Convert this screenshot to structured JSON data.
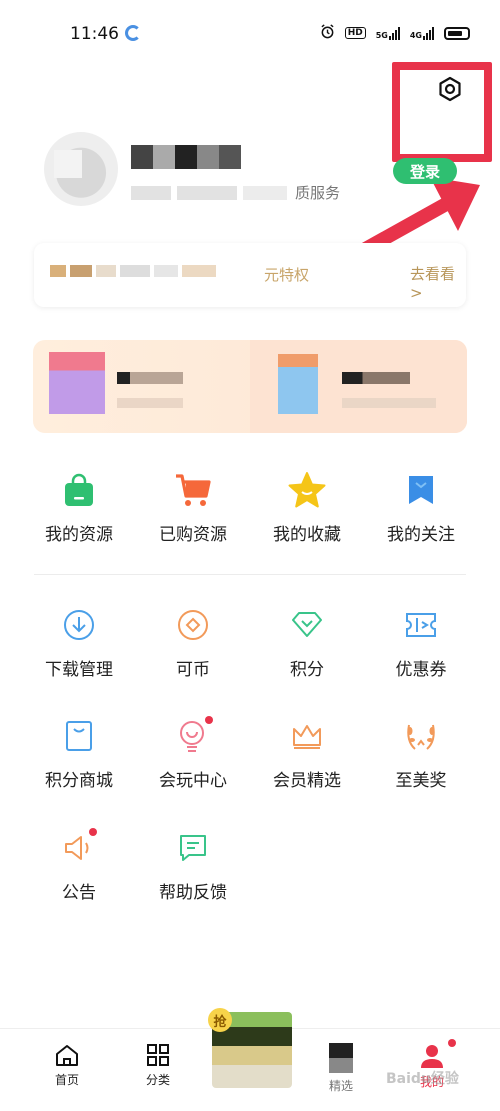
{
  "status_bar": {
    "time": "11:46",
    "hd_label": "HD",
    "net_5g": "5G",
    "net_4g": "4G"
  },
  "profile": {
    "service_text": "质服务",
    "login_label": "登录"
  },
  "privilege": {
    "text": "元特权",
    "more_label": "去看看 >"
  },
  "section_main": [
    {
      "label": "我的资源",
      "icon": "shopping-bag-icon",
      "color": "#2fbf71"
    },
    {
      "label": "已购资源",
      "icon": "shopping-cart-icon",
      "color": "#f5683a"
    },
    {
      "label": "我的收藏",
      "icon": "star-icon",
      "color": "#f5c518"
    },
    {
      "label": "我的关注",
      "icon": "bookmark-icon",
      "color": "#3a8ee6"
    }
  ],
  "section_tools_row1": [
    {
      "label": "下载管理",
      "icon": "download-icon",
      "color": "#4a9fe8"
    },
    {
      "label": "可币",
      "icon": "coin-icon",
      "color": "#f29a5a"
    },
    {
      "label": "积分",
      "icon": "diamond-icon",
      "color": "#39c48a"
    },
    {
      "label": "优惠券",
      "icon": "ticket-icon",
      "color": "#4a9fe8"
    }
  ],
  "section_tools_row2": [
    {
      "label": "积分商城",
      "icon": "shopping-bag-outline-icon",
      "color": "#4a9fe8"
    },
    {
      "label": "会玩中心",
      "icon": "lightbulb-icon",
      "color": "#f07a8e"
    },
    {
      "label": "会员精选",
      "icon": "crown-icon",
      "color": "#f29a5a"
    },
    {
      "label": "至美奖",
      "icon": "laurel-icon",
      "color": "#f29a5a"
    }
  ],
  "section_tools_row3": [
    {
      "label": "公告",
      "icon": "megaphone-icon",
      "color": "#f29a5a"
    },
    {
      "label": "帮助反馈",
      "icon": "chat-icon",
      "color": "#39c48a"
    }
  ],
  "bottom_nav": {
    "home": "首页",
    "category": "分类",
    "center_badge": "抢",
    "selected": "精选",
    "mine": "我的"
  },
  "watermark": "Baidu经验"
}
